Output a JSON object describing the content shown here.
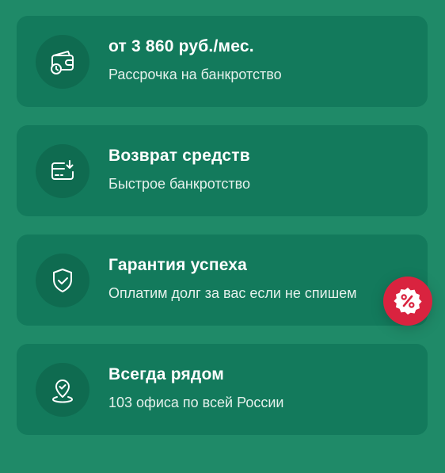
{
  "cards": [
    {
      "title": "от 3 860 руб./мес.",
      "subtitle": "Рассрочка на банкротство",
      "icon": "wallet-clock-icon"
    },
    {
      "title": "Возврат средств",
      "subtitle": "Быстрое банкротство",
      "icon": "card-download-icon"
    },
    {
      "title": "Гарантия успеха",
      "subtitle": "Оплатим долг за вас если не спишем",
      "icon": "shield-check-icon"
    },
    {
      "title": "Всегда рядом",
      "subtitle": "103 офиса по всей России",
      "icon": "location-pin-icon"
    }
  ],
  "colors": {
    "background": "#1f8a68",
    "card": "#137a5c",
    "icon_circle": "#0f6b50",
    "promo_badge": "#d9233f"
  },
  "promo_badge": {
    "icon": "percent-badge-icon"
  }
}
